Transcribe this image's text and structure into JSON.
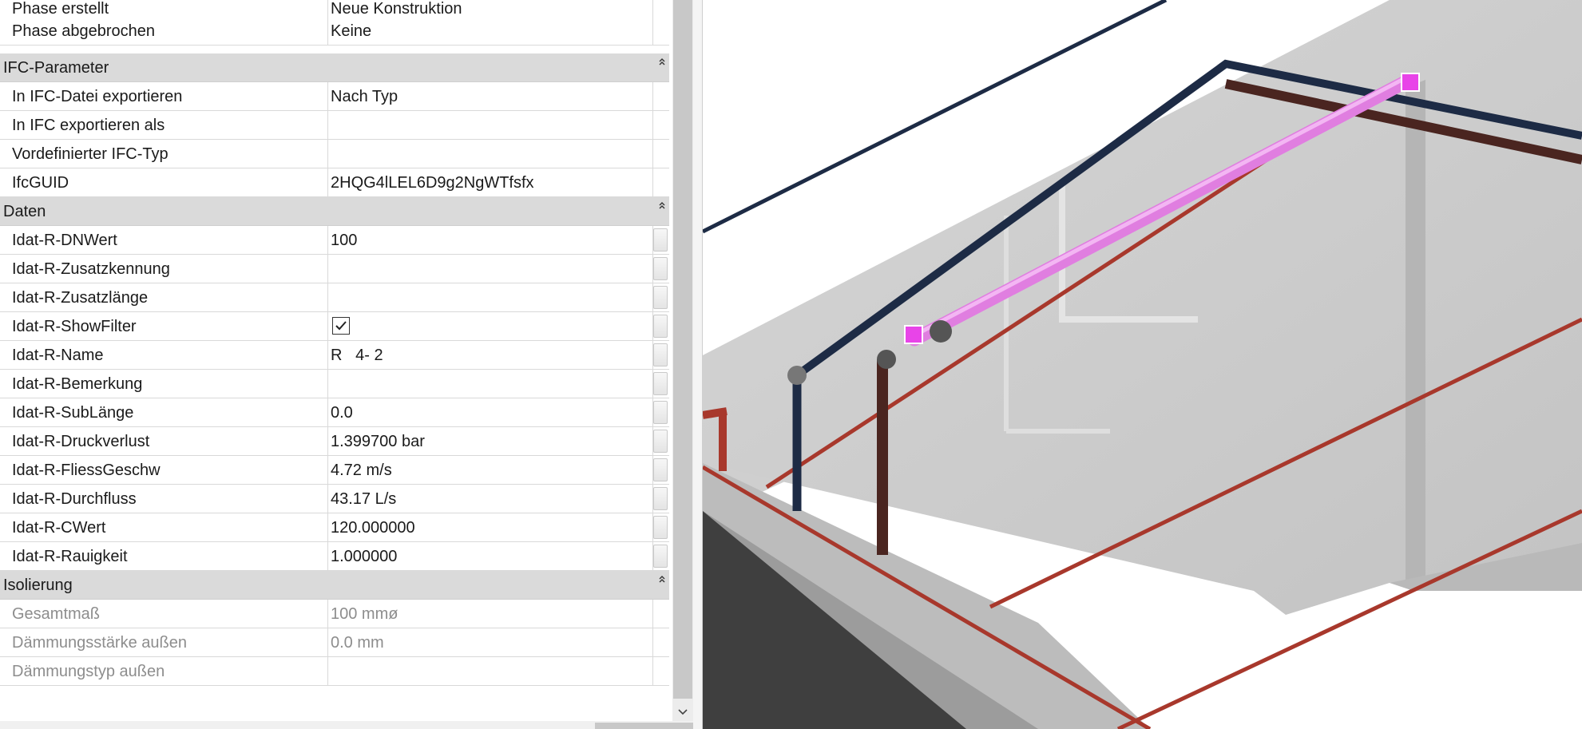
{
  "rows_top": [
    {
      "label": "Phase erstellt",
      "value": "Neue Konstruktion"
    },
    {
      "label": "Phase abgebrochen",
      "value": "Keine"
    }
  ],
  "ifc": {
    "title": "IFC-Parameter",
    "rows": [
      {
        "label": "In IFC-Datei exportieren",
        "value": "Nach Typ"
      },
      {
        "label": "In IFC exportieren als",
        "value": ""
      },
      {
        "label": "Vordefinierter IFC-Typ",
        "value": ""
      },
      {
        "label": "IfcGUID",
        "value": "2HQG4lLEL6D9g2NgWTfsfx"
      }
    ]
  },
  "daten": {
    "title": "Daten",
    "rows": [
      {
        "label": "Idat-R-DNWert",
        "value": "100"
      },
      {
        "label": "Idat-R-Zusatzkennung",
        "value": ""
      },
      {
        "label": "Idat-R-Zusatzlänge",
        "value": ""
      },
      {
        "label": "Idat-R-ShowFilter",
        "value": ""
      },
      {
        "label": "Idat-R-Name",
        "value": "R   4- 2"
      },
      {
        "label": "Idat-R-Bemerkung",
        "value": ""
      },
      {
        "label": "Idat-R-SubLänge",
        "value": "0.0"
      },
      {
        "label": "Idat-R-Druckverlust",
        "value": "1.399700 bar"
      },
      {
        "label": "Idat-R-FliessGeschw",
        "value": "4.72 m/s"
      },
      {
        "label": "Idat-R-Durchfluss",
        "value": "43.17 L/s"
      },
      {
        "label": "Idat-R-CWert",
        "value": "120.000000"
      },
      {
        "label": "Idat-R-Rauigkeit",
        "value": "1.000000"
      }
    ],
    "showfilter_checked": true
  },
  "isolierung": {
    "title": "Isolierung",
    "rows": [
      {
        "label": "Gesamtmaß",
        "value": "100 mmø"
      },
      {
        "label": "Dämmungsstärke außen",
        "value": "0.0 mm"
      },
      {
        "label": "Dämmungstyp außen",
        "value": ""
      }
    ]
  },
  "colors": {
    "pipe_navy": "#1d2b45",
    "pipe_red": "#a8382c",
    "pipe_brown": "#4a2520",
    "pipe_selected": "#e07ee0",
    "selection_marker": "#e844e8",
    "slab": "#c9c9c9"
  },
  "icons": {
    "collapse": "chevron-up-double-icon",
    "scroll_down": "chevron-down-icon",
    "checkbox": "check-icon"
  }
}
